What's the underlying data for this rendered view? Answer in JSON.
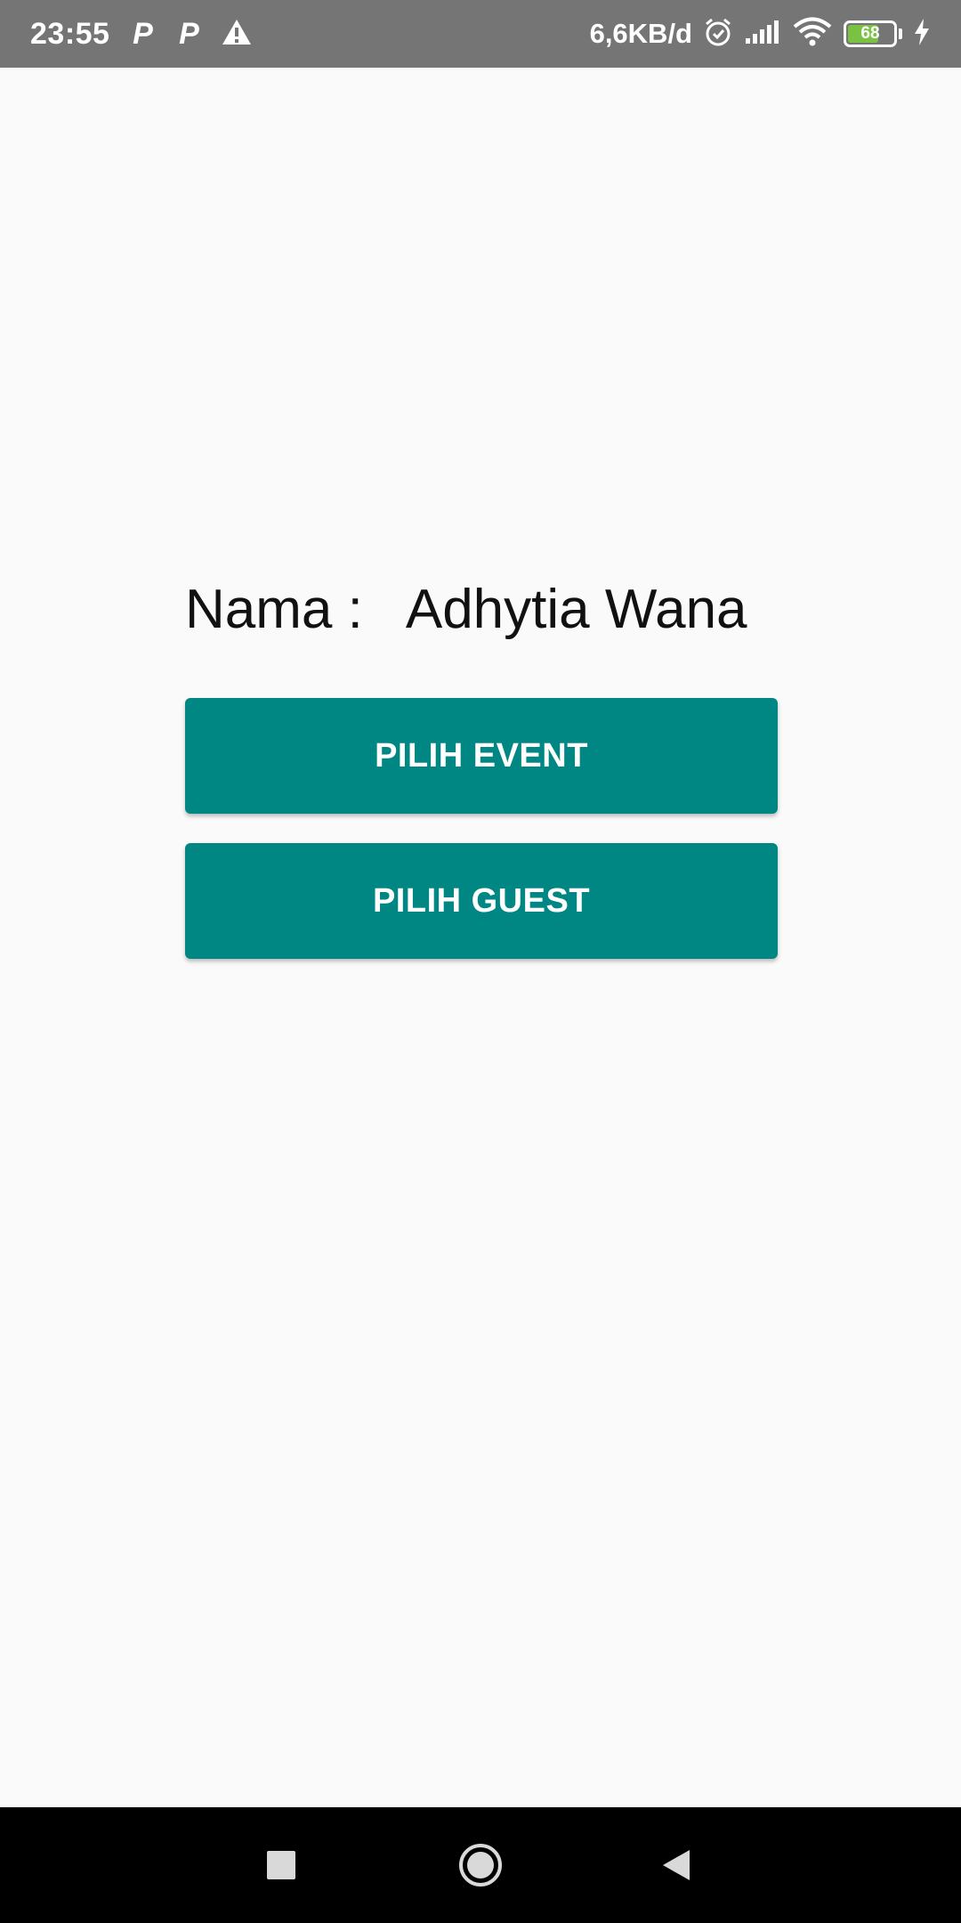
{
  "status_bar": {
    "time": "23:55",
    "notif_icon_1": "P",
    "notif_icon_2": "P",
    "net_speed": "6,6KB/d",
    "battery_level": "68",
    "battery_fraction": 0.68,
    "icons": [
      "parking-icon",
      "parking-icon",
      "warning-icon",
      "alarm-icon",
      "signal-icon",
      "wifi-icon",
      "battery-icon",
      "charging-icon"
    ]
  },
  "profile": {
    "name_label": "Nama :",
    "name_value": "Adhytia Wana"
  },
  "buttons": {
    "pilih_event": "PILIH EVENT",
    "pilih_guest": "PILIH GUEST"
  },
  "colors": {
    "accent": "#008784",
    "status_bar": "#757575",
    "background": "#fafafa",
    "nav_bar": "#000000",
    "battery_fill": "#7cc242"
  },
  "nav_bar": {
    "icons": [
      "recent-apps-icon",
      "home-icon",
      "back-icon"
    ]
  }
}
